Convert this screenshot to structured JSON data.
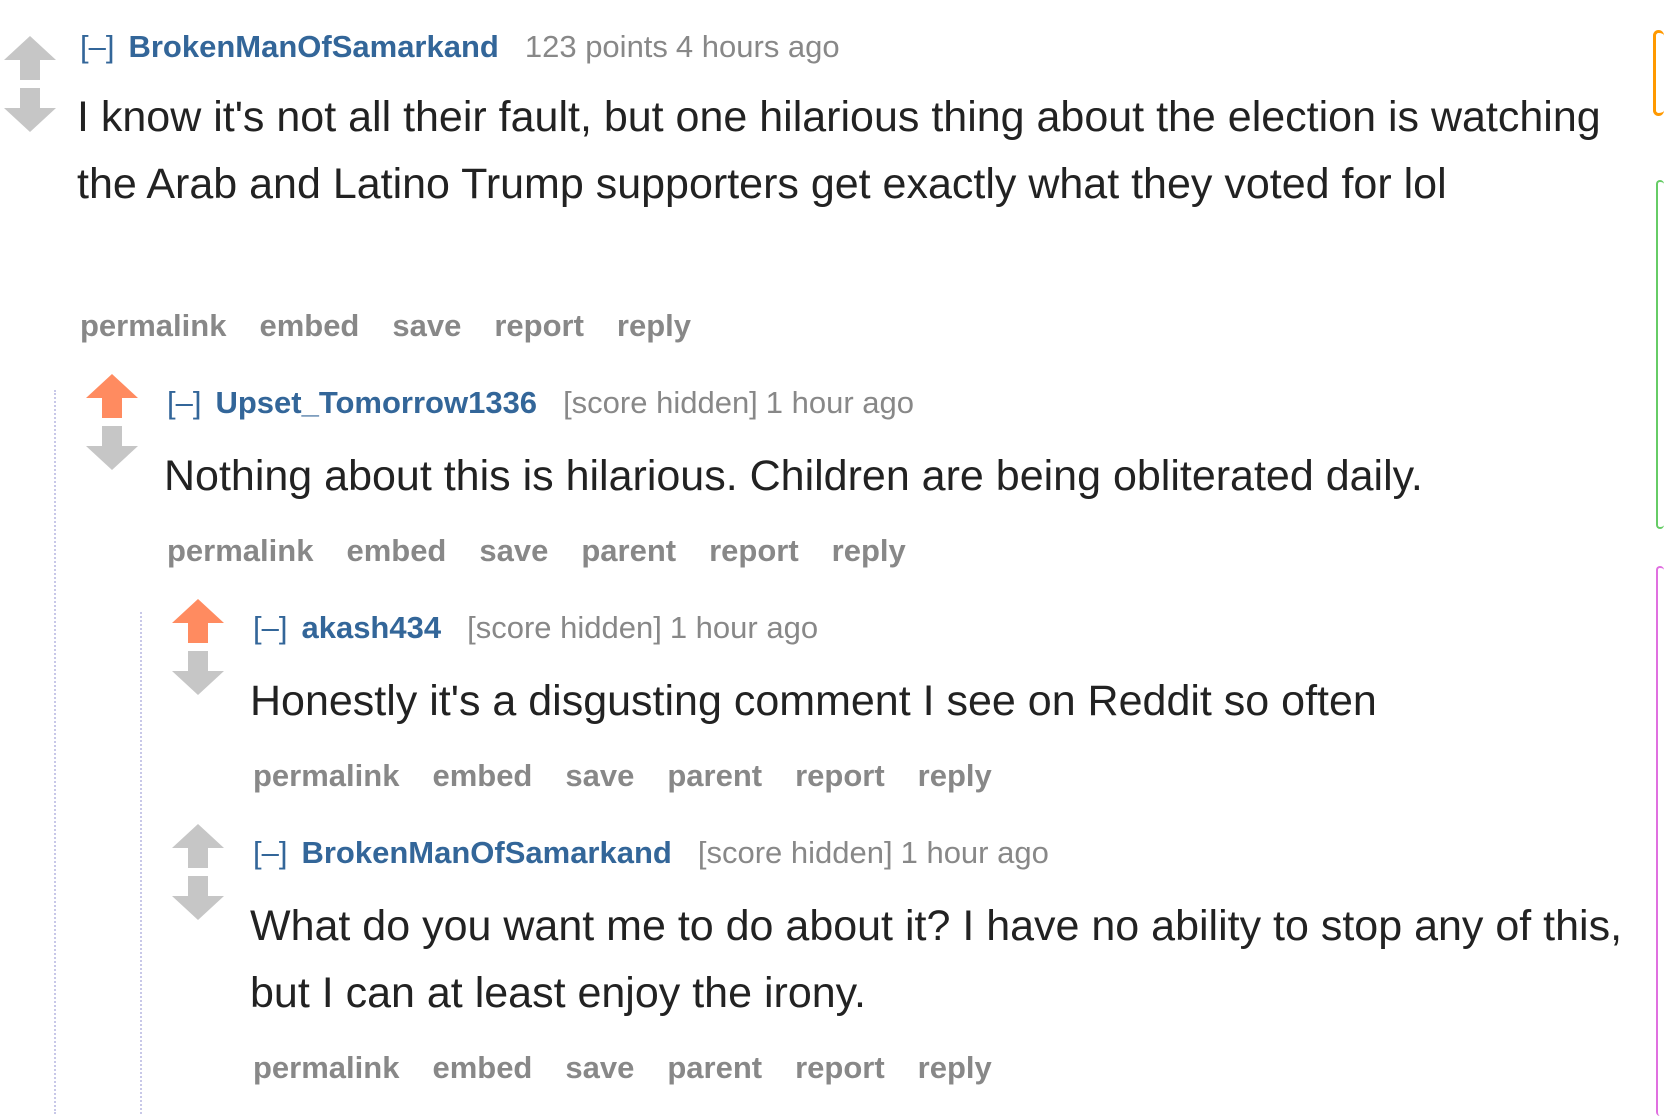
{
  "colors": {
    "link": "#336699",
    "meta": "#888888",
    "upvoted": "#ff8b60",
    "neutral_arrow": "#c6c6c6"
  },
  "comments": [
    {
      "expand": "[–]",
      "author": "BrokenManOfSamarkand",
      "score": "123 points",
      "time": "4 hours ago",
      "body": "I know it's not all their fault, but one hilarious thing about the election is watching the Arab and Latino Trump supporters get exactly what they voted for lol",
      "upvoted": false,
      "buttons": [
        "permalink",
        "embed",
        "save",
        "report",
        "reply"
      ]
    },
    {
      "expand": "[–]",
      "author": "Upset_Tomorrow1336",
      "score": "[score hidden]",
      "time": "1 hour ago",
      "body": "Nothing about this is hilarious. Children are being obliterated daily.",
      "upvoted": true,
      "buttons": [
        "permalink",
        "embed",
        "save",
        "parent",
        "report",
        "reply"
      ]
    },
    {
      "expand": "[–]",
      "author": "akash434",
      "score": "[score hidden]",
      "time": "1 hour ago",
      "body": "Honestly it's a disgusting comment I see on Reddit so often",
      "upvoted": true,
      "buttons": [
        "permalink",
        "embed",
        "save",
        "parent",
        "report",
        "reply"
      ]
    },
    {
      "expand": "[–]",
      "author": "BrokenManOfSamarkand",
      "score": "[score hidden]",
      "time": "1 hour ago",
      "body": "What do you want me to do about it? I have no ability to stop any of this, but I can at least enjoy the irony.",
      "upvoted": false,
      "buttons": [
        "permalink",
        "embed",
        "save",
        "parent",
        "report",
        "reply"
      ]
    }
  ]
}
